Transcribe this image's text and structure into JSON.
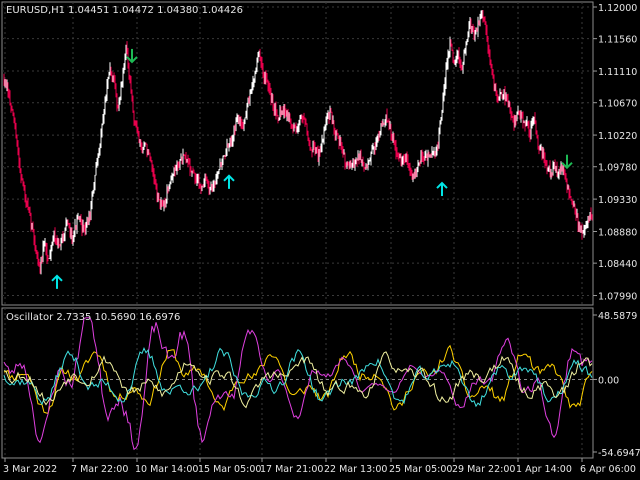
{
  "chart_data": [
    {
      "type": "candlestick",
      "title": "EURUSD,H1",
      "ohlc_label": "1.04451 1.04472 1.04380 1.04426",
      "ylim": [
        1.079,
        1.12
      ],
      "y_ticks": [
        "1.12000",
        "1.11560",
        "1.11110",
        "1.10670",
        "1.10220",
        "1.09780",
        "1.09330",
        "1.08880",
        "1.08440",
        "1.07990"
      ],
      "grid": true,
      "colors": {
        "bull": "#ffffff",
        "bear": "#e8004c",
        "arrow_up": "#00e5e5",
        "arrow_down": "#1db954",
        "grid": "#3a3a3a",
        "axis": "#9a9a9a"
      },
      "trend": [
        [
          0,
          1.1118
        ],
        [
          8,
          1.108
        ],
        [
          14,
          1.104
        ],
        [
          20,
          1.0975
        ],
        [
          26,
          1.0928
        ],
        [
          32,
          1.0895
        ],
        [
          36,
          1.0862
        ],
        [
          40,
          1.0835
        ],
        [
          44,
          1.087
        ],
        [
          48,
          1.0848
        ],
        [
          54,
          1.0885
        ],
        [
          60,
          1.0865
        ],
        [
          66,
          1.09
        ],
        [
          72,
          1.088
        ],
        [
          78,
          1.0905
        ],
        [
          84,
          1.089
        ],
        [
          90,
          1.091
        ],
        [
          94,
          1.0955
        ],
        [
          98,
          1.099
        ],
        [
          102,
          1.1035
        ],
        [
          106,
          1.108
        ],
        [
          110,
          1.1112
        ],
        [
          114,
          1.1095
        ],
        [
          118,
          1.106
        ],
        [
          122,
          1.1098
        ],
        [
          126,
          1.1145
        ],
        [
          130,
          1.109
        ],
        [
          134,
          1.1045
        ],
        [
          138,
          1.1025
        ],
        [
          142,
          1.1
        ],
        [
          146,
          1.101
        ],
        [
          150,
          1.0985
        ],
        [
          154,
          1.096
        ],
        [
          158,
          1.0935
        ],
        [
          162,
          1.092
        ],
        [
          166,
          1.0935
        ],
        [
          170,
          1.096
        ],
        [
          176,
          1.0975
        ],
        [
          182,
          1.099
        ],
        [
          188,
          1.0985
        ],
        [
          194,
          1.0965
        ],
        [
          200,
          1.095
        ],
        [
          206,
          1.096
        ],
        [
          210,
          1.094
        ],
        [
          214,
          1.0955
        ],
        [
          218,
          1.0975
        ],
        [
          222,
          1.0985
        ],
        [
          226,
          1.1
        ],
        [
          230,
          1.101
        ],
        [
          234,
          1.103
        ],
        [
          238,
          1.1045
        ],
        [
          242,
          1.1035
        ],
        [
          246,
          1.1055
        ],
        [
          250,
          1.108
        ],
        [
          254,
          1.11
        ],
        [
          258,
          1.1135
        ],
        [
          262,
          1.1115
        ],
        [
          266,
          1.1095
        ],
        [
          270,
          1.108
        ],
        [
          274,
          1.106
        ],
        [
          278,
          1.105
        ],
        [
          284,
          1.106
        ],
        [
          290,
          1.104
        ],
        [
          296,
          1.103
        ],
        [
          302,
          1.105
        ],
        [
          306,
          1.104
        ],
        [
          310,
          1.1
        ],
        [
          314,
          1.101
        ],
        [
          318,
          1.099
        ],
        [
          322,
          1.1015
        ],
        [
          326,
          1.104
        ],
        [
          330,
          1.1055
        ],
        [
          334,
          1.103
        ],
        [
          338,
          1.102
        ],
        [
          342,
          1.1
        ],
        [
          346,
          1.0985
        ],
        [
          350,
          1.0975
        ],
        [
          354,
          1.0985
        ],
        [
          358,
          1.0995
        ],
        [
          362,
          1.0985
        ],
        [
          366,
          1.0975
        ],
        [
          370,
          1.099
        ],
        [
          374,
          1.1005
        ],
        [
          378,
          1.102
        ],
        [
          382,
          1.1035
        ],
        [
          386,
          1.1045
        ],
        [
          390,
          1.103
        ],
        [
          394,
          1.101
        ],
        [
          398,
          1.099
        ],
        [
          402,
          1.0985
        ],
        [
          406,
          1.099
        ],
        [
          410,
          1.0975
        ],
        [
          414,
          1.0965
        ],
        [
          418,
          1.098
        ],
        [
          422,
          1.0995
        ],
        [
          428,
          1.099
        ],
        [
          434,
          1.0995
        ],
        [
          438,
          1.101
        ],
        [
          442,
          1.106
        ],
        [
          446,
          1.111
        ],
        [
          450,
          1.115
        ],
        [
          454,
          1.112
        ],
        [
          458,
          1.1135
        ],
        [
          462,
          1.111
        ],
        [
          466,
          1.115
        ],
        [
          470,
          1.118
        ],
        [
          474,
          1.116
        ],
        [
          478,
          1.1175
        ],
        [
          482,
          1.119
        ],
        [
          486,
          1.1175
        ],
        [
          490,
          1.112
        ],
        [
          494,
          1.1095
        ],
        [
          498,
          1.107
        ],
        [
          502,
          1.108
        ],
        [
          506,
          1.1075
        ],
        [
          510,
          1.106
        ],
        [
          514,
          1.104
        ],
        [
          518,
          1.105
        ],
        [
          522,
          1.1045
        ],
        [
          526,
          1.104
        ],
        [
          530,
          1.1025
        ],
        [
          534,
          1.105
        ],
        [
          538,
          1.101
        ],
        [
          542,
          1.0995
        ],
        [
          546,
          1.098
        ],
        [
          550,
          1.097
        ],
        [
          554,
          1.0978
        ],
        [
          558,
          1.0968
        ],
        [
          562,
          1.098
        ],
        [
          566,
          1.0955
        ],
        [
          570,
          1.094
        ],
        [
          574,
          1.092
        ],
        [
          578,
          1.09
        ],
        [
          582,
          1.0885
        ],
        [
          586,
          1.09
        ],
        [
          590,
          1.091
        ],
        [
          593,
          1.0905
        ]
      ],
      "arrows": [
        {
          "dir": "up",
          "x": 57,
          "price": 1.0818
        },
        {
          "dir": "down",
          "x": 132,
          "price": 1.1132
        },
        {
          "dir": "up",
          "x": 229,
          "price": 1.0957
        },
        {
          "dir": "up",
          "x": 442,
          "price": 1.0947
        },
        {
          "dir": "down",
          "x": 567,
          "price": 1.0985
        }
      ]
    },
    {
      "type": "line",
      "title": "Oscillator 2.7335 10.5690 16.6976",
      "ylim": [
        -54.6947,
        48.5879
      ],
      "y_ticks": [
        "48.5879",
        "0.00",
        "-54.6947"
      ],
      "zero_line": true,
      "series": [
        {
          "color": "#ffd200",
          "seed": 11,
          "amp": 14
        },
        {
          "color": "#e040e0",
          "seed": 23,
          "amp": 22
        },
        {
          "color": "#40e0e0",
          "seed": 37,
          "amp": 12
        },
        {
          "color": "#f0f0a0",
          "seed": 53,
          "amp": 10
        }
      ]
    }
  ],
  "x_axis_labels": [
    "3 Mar 2022",
    "7 Mar 22:00",
    "10 Mar 14:00",
    "15 Mar 05:00",
    "17 Mar 21:00",
    "22 Mar 13:00",
    "25 Mar 05:00",
    "29 Mar 22:00",
    "1 Apr 14:00",
    "6 Apr 06:00"
  ]
}
